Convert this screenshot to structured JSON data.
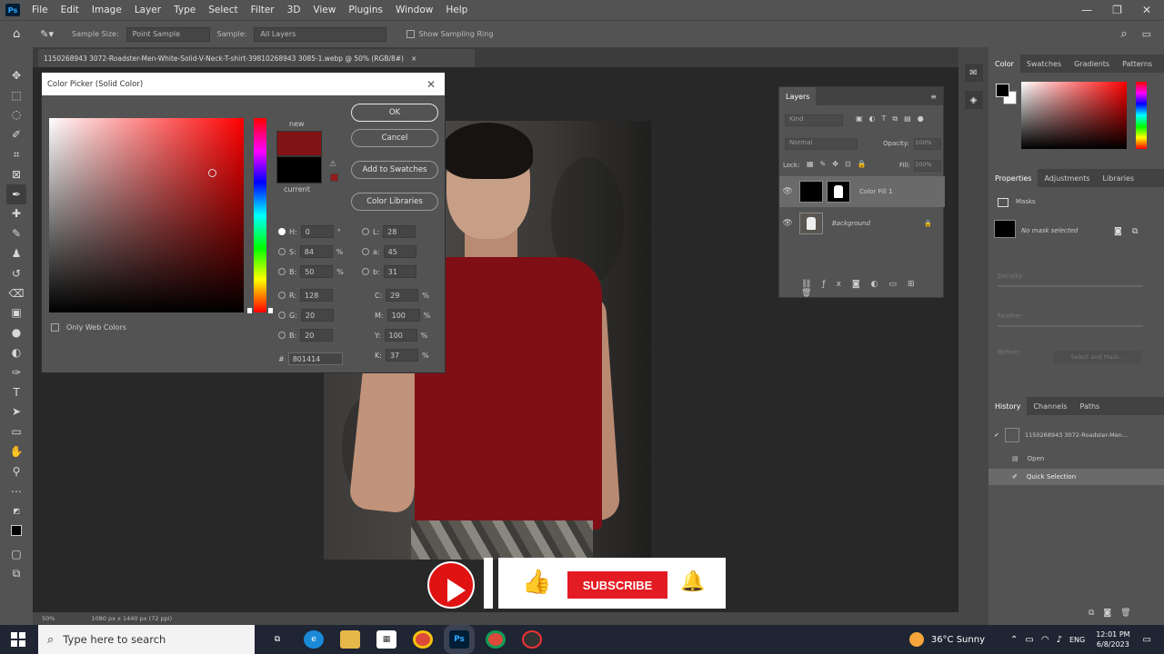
{
  "menubar": {
    "app_logo": "Ps",
    "items": [
      "File",
      "Edit",
      "Image",
      "Layer",
      "Type",
      "Select",
      "Filter",
      "3D",
      "View",
      "Plugins",
      "Window",
      "Help"
    ],
    "window_controls": [
      "—",
      "❐",
      "✕"
    ]
  },
  "options_bar": {
    "sample_size_label": "Sample Size:",
    "sample_size_value": "Point Sample",
    "sample_label": "Sample:",
    "sample_value": "All Layers",
    "show_ring_label": "Show Sampling Ring"
  },
  "document_tab": {
    "title": "1150268943 3072-Roadster-Men-White-Solid-V-Neck-T-shirt-39810268943 3085-1.webp @ 50% (RGB/8#)",
    "close": "×"
  },
  "status_bar": {
    "zoom": "50%",
    "doc_info": "1080 px x 1440 px (72 ppi)"
  },
  "color_picker": {
    "title": "Color Picker (Solid Color)",
    "close": "✕",
    "new_label": "new",
    "current_label": "current",
    "buttons": {
      "ok": "OK",
      "cancel": "Cancel",
      "add_to_swatches": "Add to Swatches",
      "color_libraries": "Color Libraries"
    },
    "only_web_colors": "Only Web Colors",
    "new_color": "#801414",
    "current_color": "#000000",
    "fields": {
      "H": "0",
      "H_unit": "°",
      "S": "84",
      "S_unit": "%",
      "B": "50",
      "B_unit": "%",
      "R": "128",
      "G": "20",
      "Bb": "20",
      "L": "28",
      "a": "45",
      "b": "31",
      "C": "29",
      "C_unit": "%",
      "M": "100",
      "M_unit": "%",
      "Y": "100",
      "Y_unit": "%",
      "K": "37",
      "K_unit": "%",
      "hex": "801414"
    },
    "labels": {
      "H": "H:",
      "S": "S:",
      "B": "B:",
      "R": "R:",
      "G": "G:",
      "Bb": "B:",
      "L": "L:",
      "a": "a:",
      "b": "b:",
      "C": "C:",
      "M": "M:",
      "Y": "Y:",
      "K": "K:",
      "hash": "#"
    }
  },
  "layers_panel": {
    "tab": "Layers",
    "search_placeholder": "Kind",
    "blend_mode": "Normal",
    "opacity_label": "Opacity:",
    "opacity_value": "100%",
    "lock_label": "Lock:",
    "fill_label": "Fill:",
    "fill_value": "100%",
    "layers": [
      {
        "name": "Color Fill 1",
        "selected": true
      },
      {
        "name": "Background",
        "selected": false
      }
    ]
  },
  "color_panel": {
    "tabs": [
      "Color",
      "Swatches",
      "Gradients",
      "Patterns"
    ]
  },
  "properties_panel": {
    "tabs": [
      "Properties",
      "Adjustments",
      "Libraries"
    ],
    "section": "Masks",
    "mask_text": "No mask selected",
    "density": "Density:",
    "feather": "Feather:",
    "refine": "Refine:",
    "select_mask": "Select and Mask..."
  },
  "history_panel": {
    "tabs": [
      "History",
      "Channels",
      "Paths"
    ],
    "items": [
      "1150268943 3072-Roadster-Men...",
      "Open",
      "Quick Selection"
    ]
  },
  "overlay": {
    "subscribe": "SUBSCRIBE"
  },
  "taskbar": {
    "search_placeholder": "Type here to search",
    "weather": "36°C  Sunny",
    "lang": "ENG",
    "time": "12:01 PM",
    "date": "6/8/2023"
  }
}
